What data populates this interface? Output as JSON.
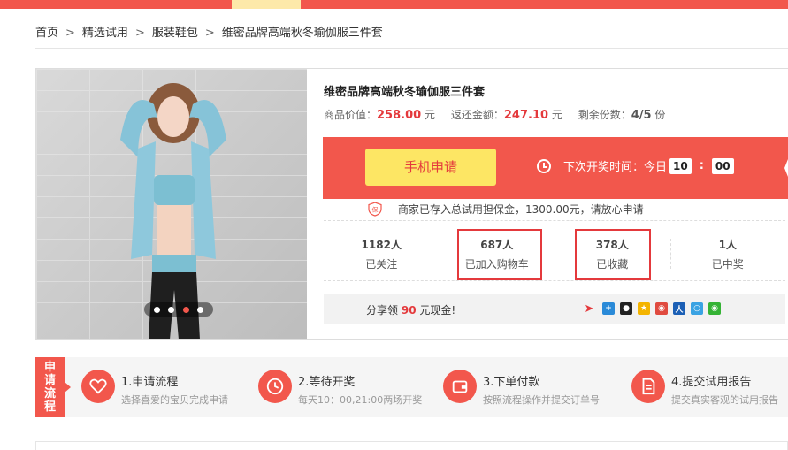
{
  "breadcrumb": {
    "items": [
      "首页",
      "精选试用",
      "服装鞋包",
      "维密品牌高端秋冬瑜伽服三件套"
    ],
    "separator": ">"
  },
  "product": {
    "title": "维密品牌高端秋冬瑜伽服三件套",
    "price_label": "商品价值：",
    "price_value": "258.00",
    "refund_label": "返还金额：",
    "refund_value": "247.10",
    "currency": "元",
    "remaining_label": "剩余份数：",
    "remaining_value": "4/5",
    "remaining_unit": "份",
    "carousel_active": 3,
    "carousel_count": 4
  },
  "apply": {
    "button_label": "手机申请",
    "next_draw_label": "下次开奖时间：今日",
    "hour": "10",
    "minute": "00",
    "colon": ":"
  },
  "deposit": {
    "icon_char": "保",
    "text": "商家已存入总试用担保金，1300.00元，请放心申请"
  },
  "stats": [
    {
      "num": "1182人",
      "label": "已关注"
    },
    {
      "num": "687人",
      "label": "已加入购物车"
    },
    {
      "num": "378人",
      "label": "已收藏"
    },
    {
      "num": "1人",
      "label": "已中奖"
    }
  ],
  "share": {
    "prefix": "分享领",
    "amount": "90",
    "suffix": "元现金!"
  },
  "process": {
    "tag": [
      "申",
      "请",
      "流",
      "程"
    ],
    "steps": [
      {
        "title": "1.申请流程",
        "desc": "选择喜爱的宝贝完成申请",
        "icon": "heart-icon"
      },
      {
        "title": "2.等待开奖",
        "desc": "每天10：00,21:00两场开奖",
        "icon": "clock-icon"
      },
      {
        "title": "3.下单付款",
        "desc": "按照流程操作并提交订单号",
        "icon": "wallet-icon"
      },
      {
        "title": "4.提交试用报告",
        "desc": "提交真实客观的试用报告",
        "icon": "document-icon"
      }
    ]
  },
  "colors": {
    "accent": "#f2574c",
    "price_red": "#e4393c",
    "button_yellow": "#fde664"
  }
}
